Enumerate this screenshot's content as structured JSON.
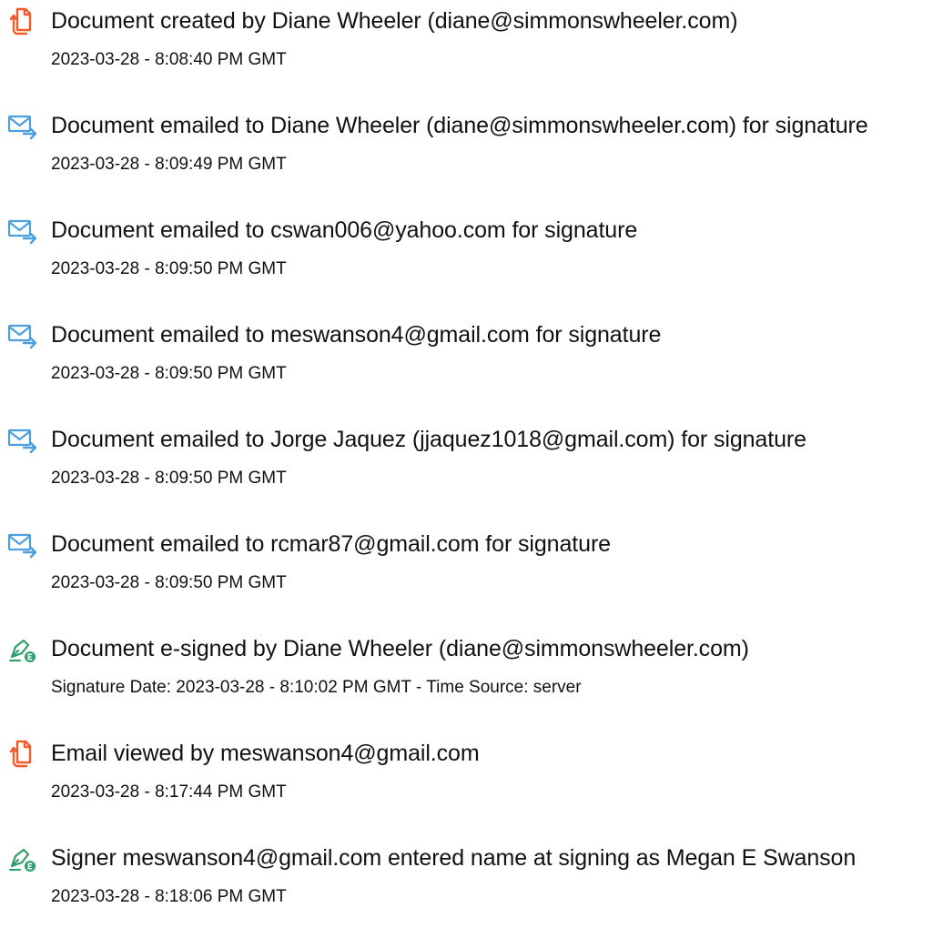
{
  "colors": {
    "doc_icon": "#f15a29",
    "mail_icon": "#4a9fe0",
    "sign_icon": "#2e9e6b"
  },
  "entries": [
    {
      "icon": "document-icon",
      "title": "Document created by Diane Wheeler (diane@simmonswheeler.com)",
      "meta": "2023-03-28 - 8:08:40 PM GMT"
    },
    {
      "icon": "email-icon",
      "title": "Document emailed to Diane Wheeler (diane@simmonswheeler.com) for signature",
      "meta": "2023-03-28 - 8:09:49 PM GMT"
    },
    {
      "icon": "email-icon",
      "title": "Document emailed to cswan006@yahoo.com for signature",
      "meta": "2023-03-28 - 8:09:50 PM GMT"
    },
    {
      "icon": "email-icon",
      "title": "Document emailed to meswanson4@gmail.com for signature",
      "meta": "2023-03-28 - 8:09:50 PM GMT"
    },
    {
      "icon": "email-icon",
      "title": "Document emailed to Jorge Jaquez (jjaquez1018@gmail.com) for signature",
      "meta": "2023-03-28 - 8:09:50 PM GMT"
    },
    {
      "icon": "email-icon",
      "title": "Document emailed to rcmar87@gmail.com for signature",
      "meta": "2023-03-28 - 8:09:50 PM GMT"
    },
    {
      "icon": "esign-icon",
      "title": "Document e-signed by Diane Wheeler (diane@simmonswheeler.com)",
      "meta": "Signature Date: 2023-03-28 - 8:10:02 PM GMT - Time Source: server"
    },
    {
      "icon": "document-icon",
      "title": "Email viewed by meswanson4@gmail.com",
      "meta": "2023-03-28 - 8:17:44 PM GMT"
    },
    {
      "icon": "esign-icon",
      "title": "Signer meswanson4@gmail.com entered name at signing as Megan E Swanson",
      "meta": "2023-03-28 - 8:18:06 PM GMT"
    }
  ]
}
